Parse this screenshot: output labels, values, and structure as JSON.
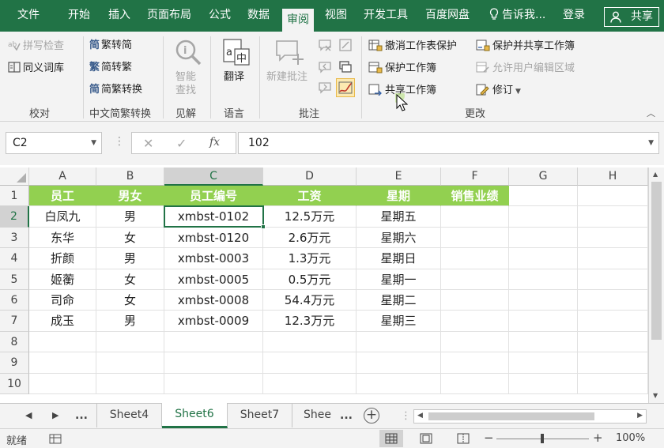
{
  "menu": {
    "tabs": [
      "文件",
      "开始",
      "插入",
      "页面布局",
      "公式",
      "数据",
      "审阅",
      "视图",
      "开发工具",
      "百度网盘"
    ],
    "active_tab": "审阅",
    "tell_me": "告诉我...",
    "login": "登录",
    "share": "共享"
  },
  "ribbon": {
    "proofing": {
      "spell_check": "拼写检查",
      "thesaurus": "同义词库",
      "label": "校对"
    },
    "chinese": {
      "to_traditional": "繁转简",
      "to_simplified": "简转繁",
      "convert": "简繁转换",
      "label": "中文简繁转换"
    },
    "insights": {
      "smart_lookup_1": "智能",
      "smart_lookup_2": "查找",
      "label": "见解"
    },
    "language": {
      "translate": "翻译",
      "label": "语言"
    },
    "comments": {
      "new_comment": "新建批注",
      "label": "批注"
    },
    "changes": {
      "unprotect_sheet": "撤消工作表保护",
      "protect_workbook": "保护工作簿",
      "share_workbook": "共享工作簿",
      "protect_share": "保护并共享工作簿",
      "allow_edit_ranges": "允许用户编辑区域",
      "track_changes": "修订",
      "label": "更改"
    }
  },
  "formula_bar": {
    "name_box": "C2",
    "formula": "102"
  },
  "sheet": {
    "columns": [
      "A",
      "B",
      "C",
      "D",
      "E",
      "F",
      "G",
      "H"
    ],
    "rows": [
      "1",
      "2",
      "3",
      "4",
      "5",
      "6",
      "7",
      "8",
      "9",
      "10"
    ],
    "header": [
      "员工",
      "男女",
      "员工编号",
      "工资",
      "星期",
      "销售业绩"
    ],
    "data": [
      [
        "白凤九",
        "男",
        "xmbst-0102",
        "12.5万元",
        "星期五",
        ""
      ],
      [
        "东华",
        "女",
        "xmbst-0120",
        "2.6万元",
        "星期六",
        ""
      ],
      [
        "折颜",
        "男",
        "xmbst-0003",
        "1.3万元",
        "星期日",
        ""
      ],
      [
        "姬蘅",
        "女",
        "xmbst-0005",
        "0.5万元",
        "星期一",
        ""
      ],
      [
        "司命",
        "女",
        "xmbst-0008",
        "54.4万元",
        "星期二",
        ""
      ],
      [
        "成玉",
        "男",
        "xmbst-0009",
        "12.3万元",
        "星期三",
        ""
      ]
    ]
  },
  "tabs": {
    "more_left": "...",
    "items": [
      "Sheet4",
      "Sheet6",
      "Sheet7",
      "Shee"
    ],
    "active": "Sheet6",
    "more_right": "..."
  },
  "status": {
    "ready": "就绪",
    "zoom": "100%"
  },
  "colors": {
    "brand": "#217346",
    "header_fill": "#92d050"
  }
}
